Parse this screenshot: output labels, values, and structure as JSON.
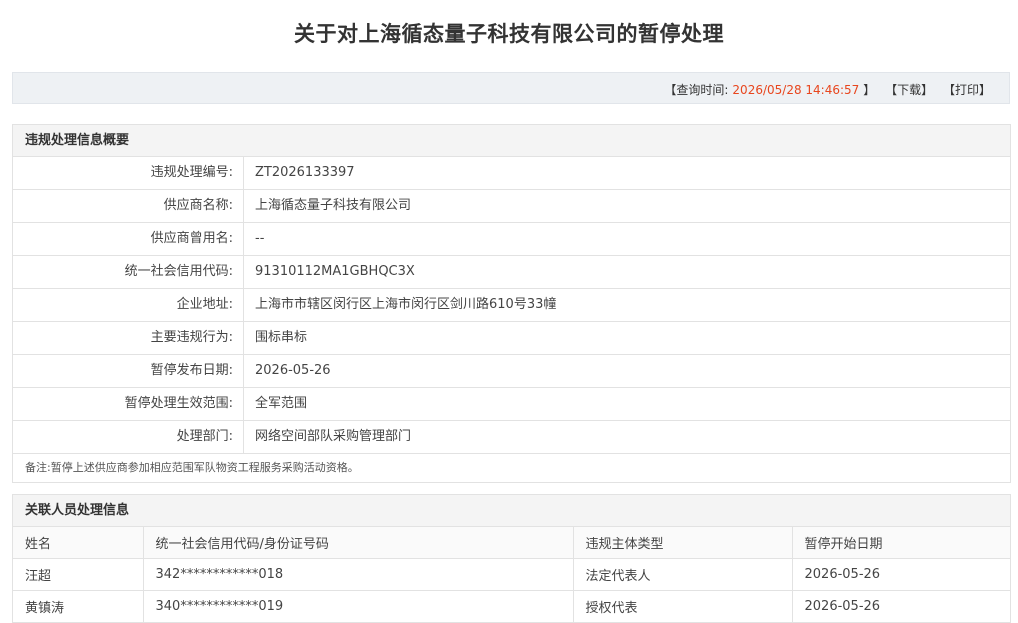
{
  "page": {
    "title": "关于对上海循态量子科技有限公司的暂停处理"
  },
  "toolbar": {
    "query_prefix": "【查询时间:",
    "query_time": "2026/05/28 14:46:57",
    "query_suffix": "】",
    "download": "【下载】",
    "print": "【打印】"
  },
  "summary": {
    "header": "违规处理信息概要",
    "rows": [
      {
        "label": "违规处理编号:",
        "value": "ZT2026133397"
      },
      {
        "label": "供应商名称:",
        "value": "上海循态量子科技有限公司"
      },
      {
        "label": "供应商曾用名:",
        "value": "--"
      },
      {
        "label": "统一社会信用代码:",
        "value": "91310112MA1GBHQC3X"
      },
      {
        "label": "企业地址:",
        "value": "上海市市辖区闵行区上海市闵行区剑川路610号33幢"
      },
      {
        "label": "主要违规行为:",
        "value": "围标串标"
      },
      {
        "label": "暂停发布日期:",
        "value": "2026-05-26"
      },
      {
        "label": "暂停处理生效范围:",
        "value": "全军范围"
      },
      {
        "label": "处理部门:",
        "value": "网络空间部队采购管理部门"
      }
    ],
    "note": "备注:暂停上述供应商参加相应范围军队物资工程服务采购活动资格。"
  },
  "people": {
    "header": "关联人员处理信息",
    "columns": [
      "姓名",
      "统一社会信用代码/身份证号码",
      "违规主体类型",
      "暂停开始日期"
    ],
    "rows": [
      [
        "汪超",
        "342************018",
        "法定代表人",
        "2026-05-26"
      ],
      [
        "黄镇涛",
        "340************019",
        "授权代表",
        "2026-05-26"
      ]
    ]
  }
}
